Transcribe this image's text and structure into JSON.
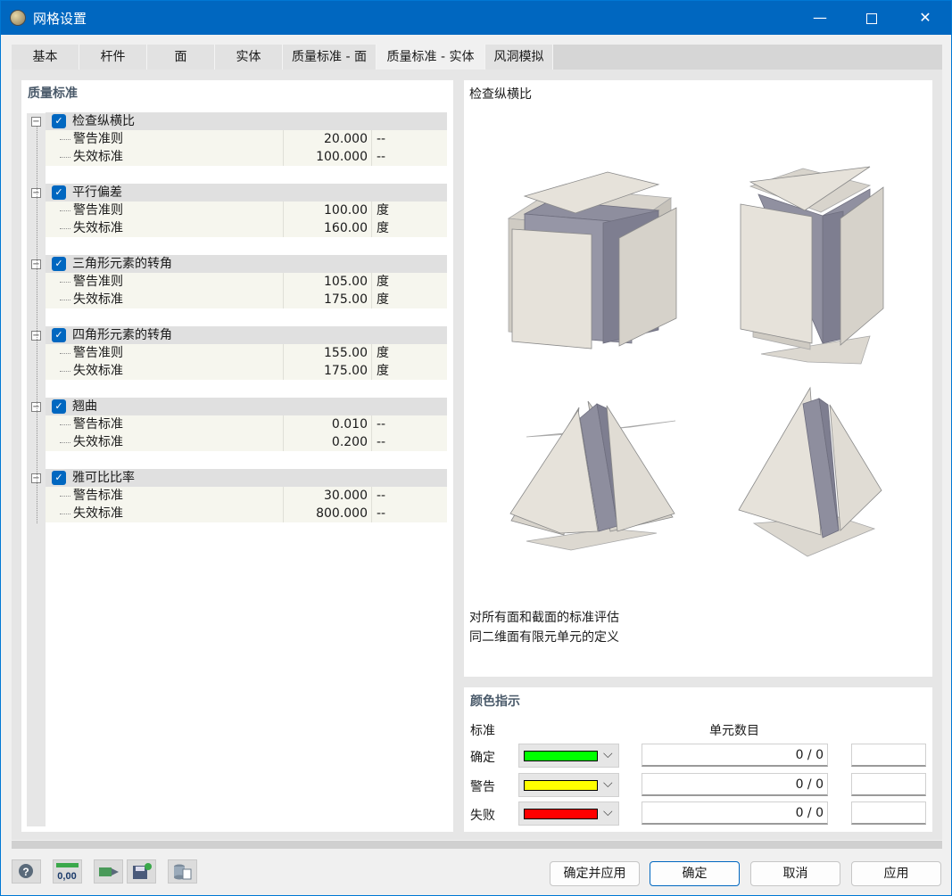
{
  "window": {
    "title": "网格设置",
    "minimize": "—",
    "close": "✕"
  },
  "tabs": [
    {
      "label": "基本"
    },
    {
      "label": "杆件"
    },
    {
      "label": "面"
    },
    {
      "label": "实体"
    },
    {
      "label": "质量标准 - 面"
    },
    {
      "label": "质量标准 - 实体",
      "active": true
    },
    {
      "label": "风洞模拟"
    }
  ],
  "quality": {
    "title": "质量标准",
    "groups": [
      {
        "label": "检查纵横比",
        "checked": true,
        "rows": [
          {
            "label": "警告准则",
            "value": "20.000",
            "unit": "--"
          },
          {
            "label": "失效标准",
            "value": "100.000",
            "unit": "--"
          }
        ]
      },
      {
        "label": "平行偏差",
        "checked": true,
        "rows": [
          {
            "label": "警告准则",
            "value": "100.00",
            "unit": "度"
          },
          {
            "label": "失效标准",
            "value": "160.00",
            "unit": "度"
          }
        ]
      },
      {
        "label": "三角形元素的转角",
        "checked": true,
        "rows": [
          {
            "label": "警告准则",
            "value": "105.00",
            "unit": "度"
          },
          {
            "label": "失效标准",
            "value": "175.00",
            "unit": "度"
          }
        ]
      },
      {
        "label": "四角形元素的转角",
        "checked": true,
        "rows": [
          {
            "label": "警告准则",
            "value": "155.00",
            "unit": "度"
          },
          {
            "label": "失效标准",
            "value": "175.00",
            "unit": "度"
          }
        ]
      },
      {
        "label": "翘曲",
        "checked": true,
        "rows": [
          {
            "label": "警告标准",
            "value": "0.010",
            "unit": "--"
          },
          {
            "label": "失效标准",
            "value": "0.200",
            "unit": "--"
          }
        ]
      },
      {
        "label": "雅可比比率",
        "checked": true,
        "rows": [
          {
            "label": "警告标准",
            "value": "30.000",
            "unit": "--"
          },
          {
            "label": "失效标准",
            "value": "800.000",
            "unit": "--"
          }
        ]
      }
    ]
  },
  "preview": {
    "title": "检查纵横比",
    "note_line1": "对所有面和截面的标准评估",
    "note_line2": "同二维面有限元单元的定义"
  },
  "color_indicator": {
    "title": "颜色指示",
    "col_criteria": "标准",
    "col_count": "单元数目",
    "rows": [
      {
        "label": "确定",
        "color": "#00ff00",
        "count": "0 / 0"
      },
      {
        "label": "警告",
        "color": "#ffff00",
        "count": "0 / 0"
      },
      {
        "label": "失败",
        "color": "#ff0000",
        "count": "0 / 0"
      }
    ]
  },
  "toolbar_icons": [
    "help-icon",
    "decimal-format-icon",
    "export-icon",
    "save-settings-icon",
    "database-icon"
  ],
  "decimal_icon_text": "0,00",
  "footer": {
    "apply_ok": "确定并应用",
    "ok": "确定",
    "cancel": "取消",
    "apply": "应用"
  }
}
